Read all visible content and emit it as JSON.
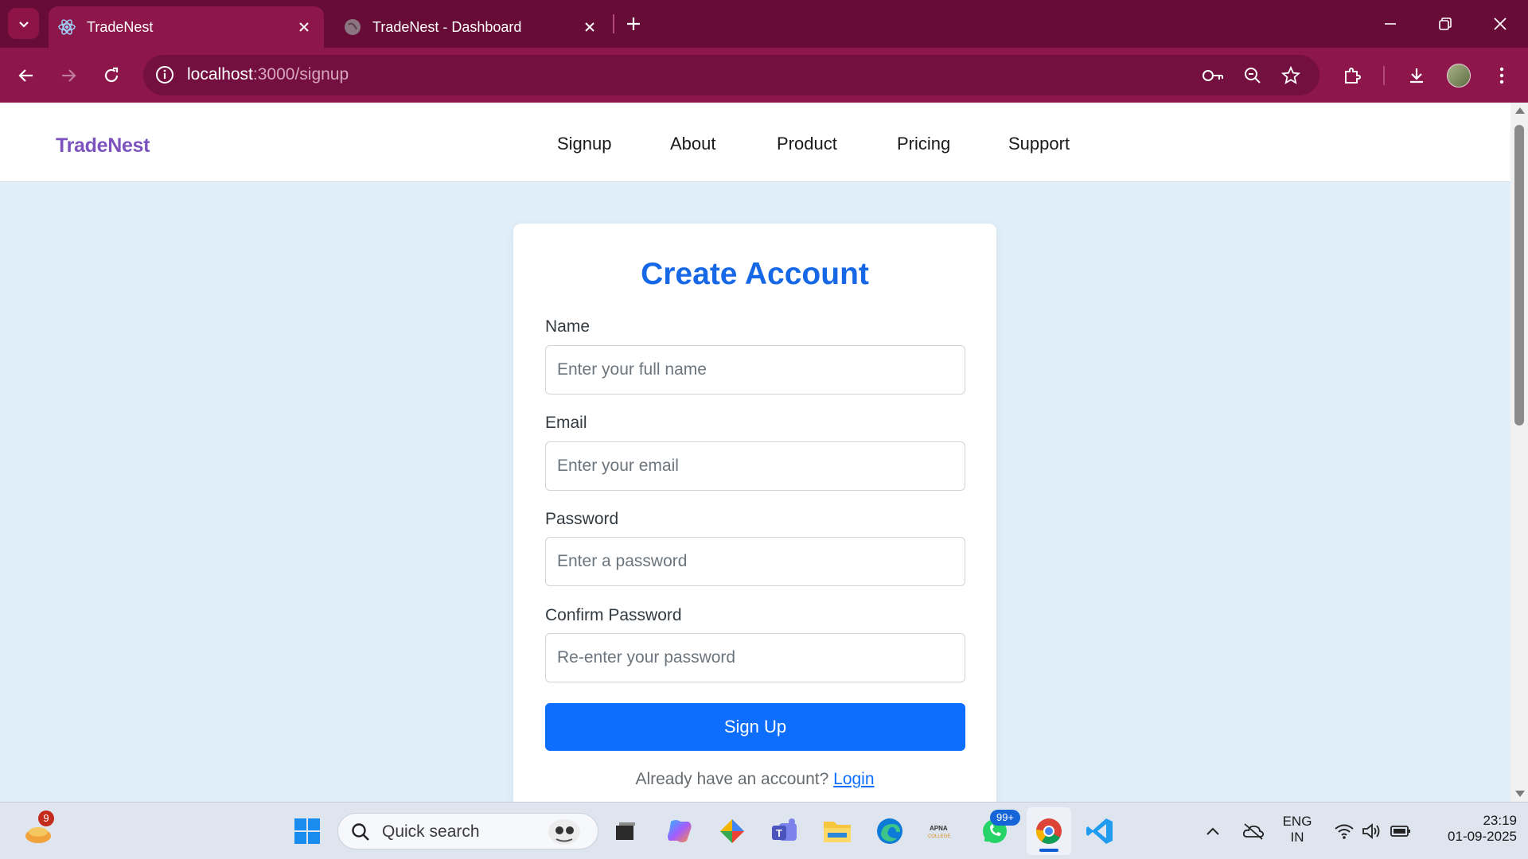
{
  "browser": {
    "tabs": [
      {
        "title": "TradeNest",
        "active": true
      },
      {
        "title": "TradeNest - Dashboard",
        "active": false
      }
    ],
    "url_host": "localhost",
    "url_path": ":3000/signup",
    "accent_color": "#8d164a"
  },
  "site": {
    "brand": "TradeNest",
    "nav": [
      "Signup",
      "About",
      "Product",
      "Pricing",
      "Support"
    ]
  },
  "form": {
    "title": "Create Account",
    "fields": [
      {
        "label": "Name",
        "placeholder": "Enter your full name"
      },
      {
        "label": "Email",
        "placeholder": "Enter your email"
      },
      {
        "label": "Password",
        "placeholder": "Enter a password"
      },
      {
        "label": "Confirm Password",
        "placeholder": "Re-enter your password"
      }
    ],
    "submit_label": "Sign Up",
    "footer_text": "Already have an account?",
    "footer_link": "Login",
    "button_color": "#0d6efd"
  },
  "taskbar": {
    "widget_badge": "9",
    "search_placeholder": "Quick search",
    "whatsapp_badge": "99+",
    "language": "ENG",
    "region": "IN",
    "time": "23:19",
    "date": "01-09-2025"
  }
}
